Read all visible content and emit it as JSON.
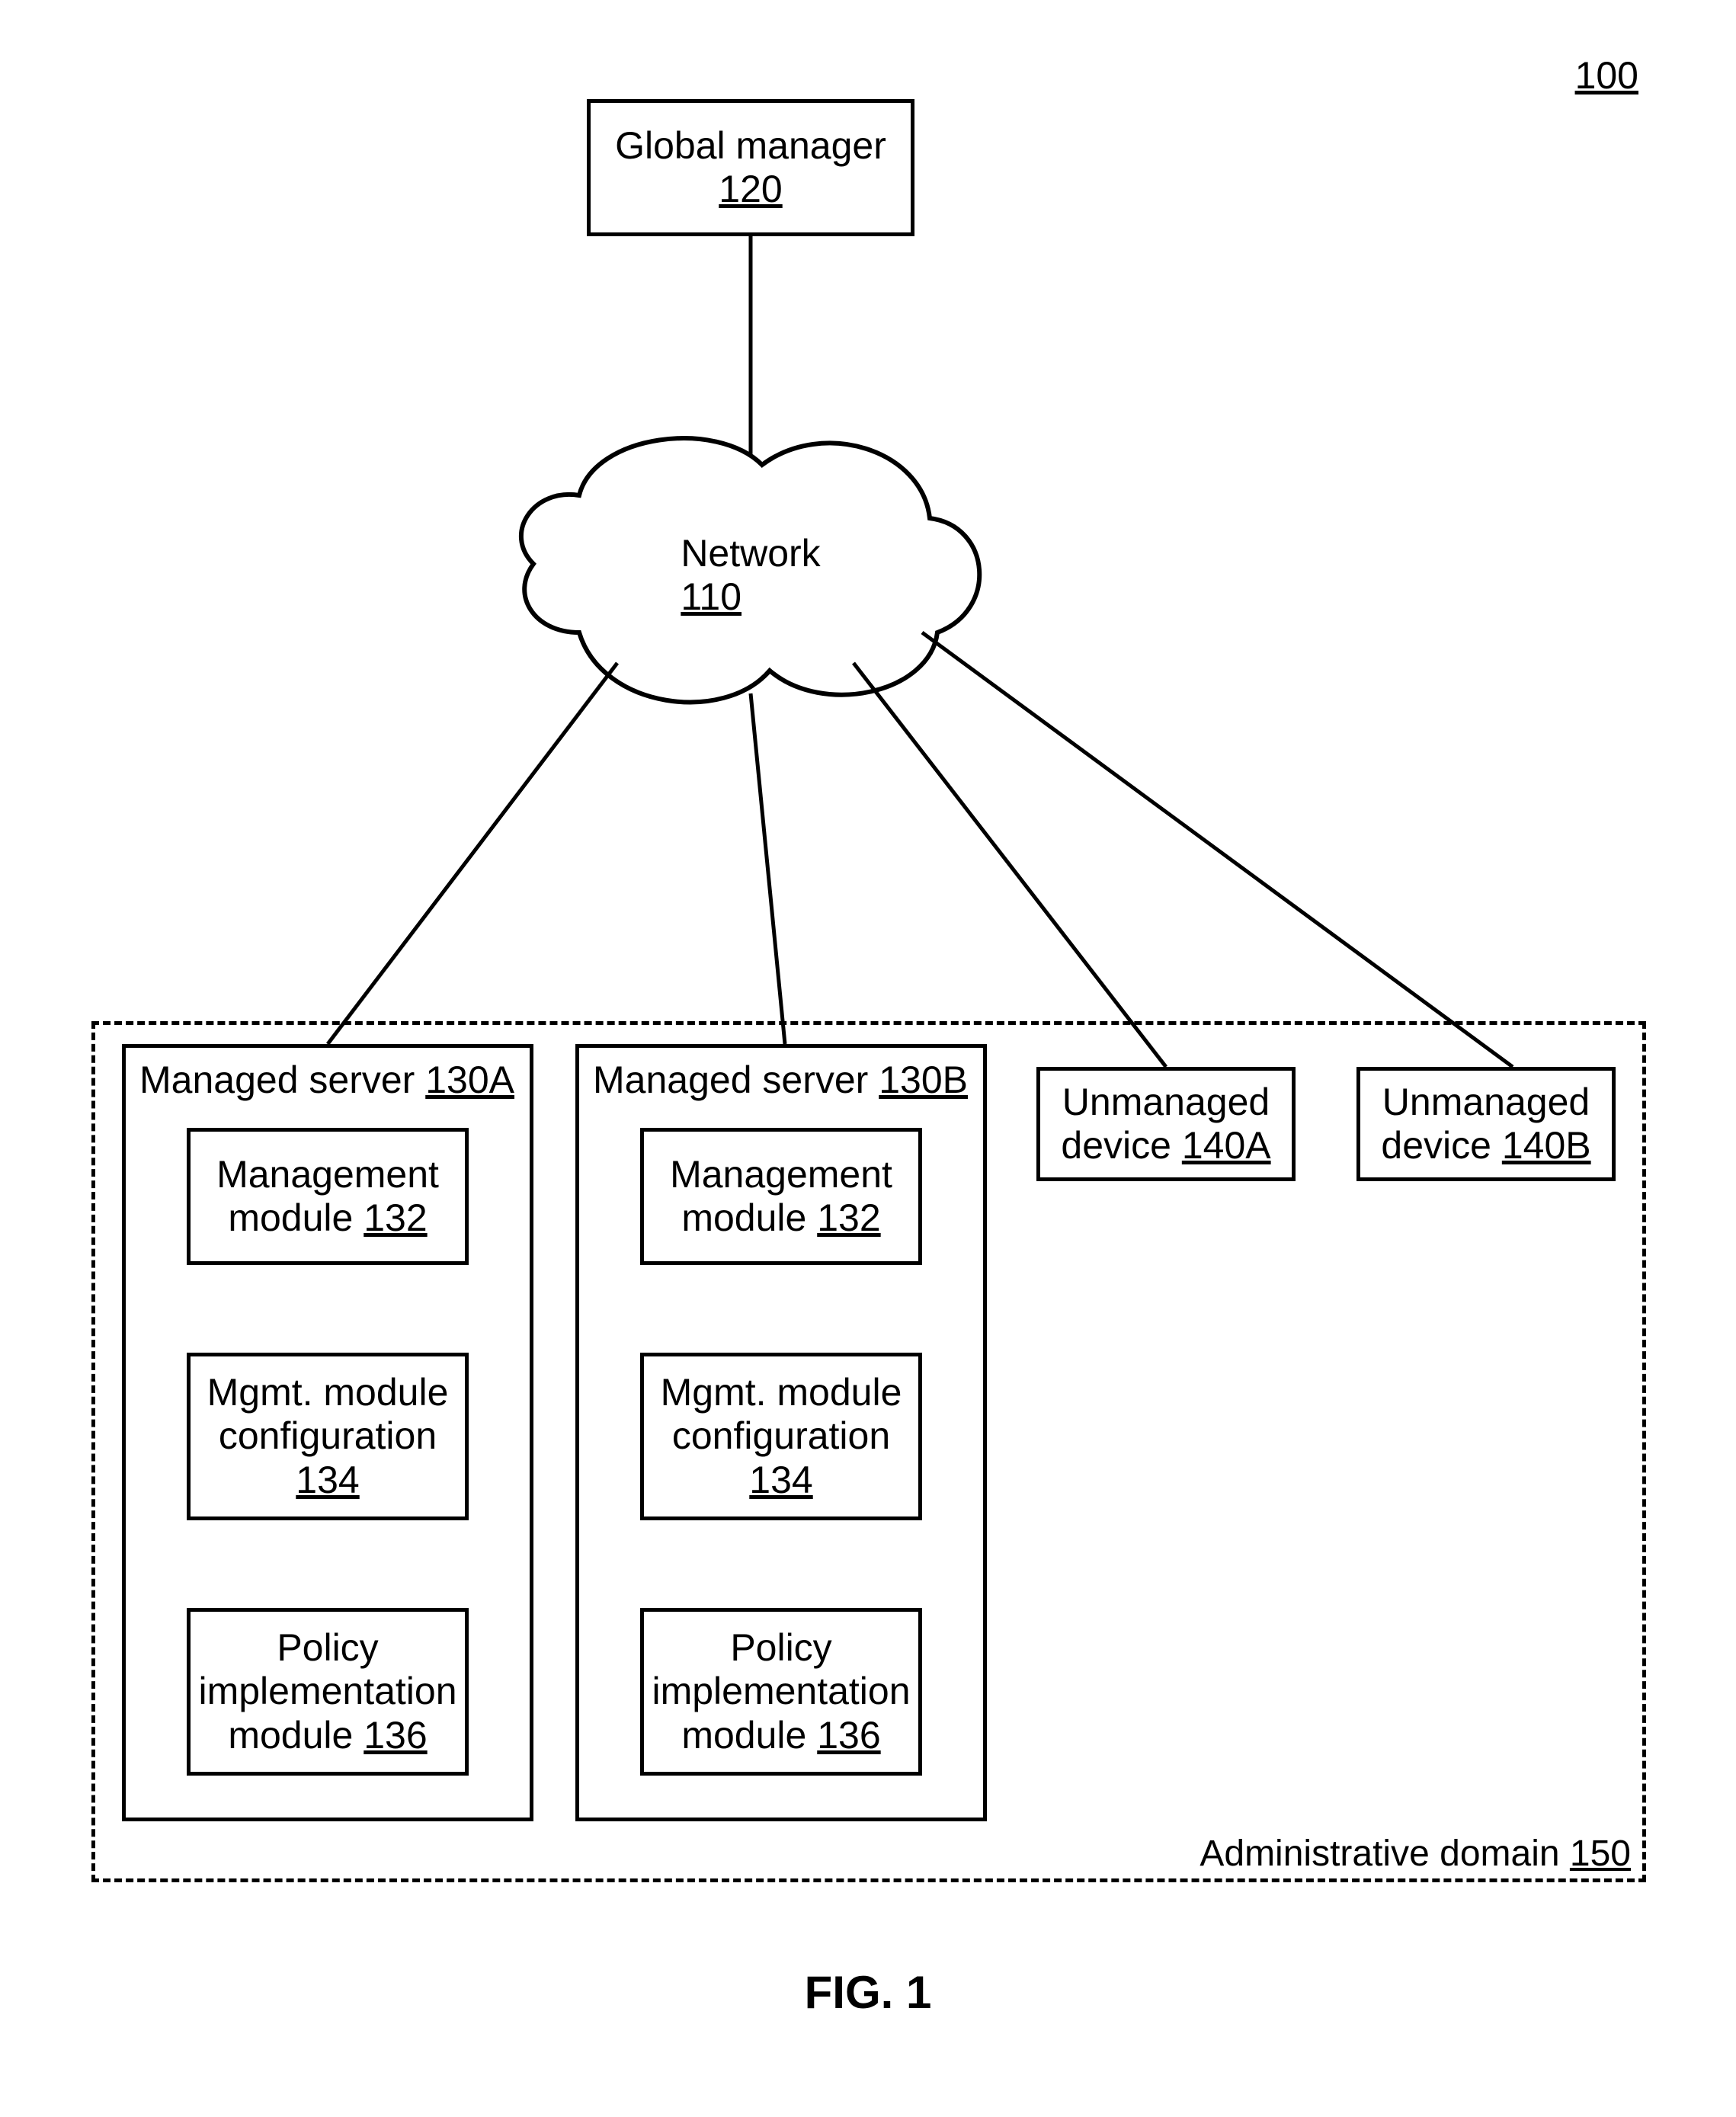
{
  "figure_ref": "100",
  "figure_title": "FIG. 1",
  "global_manager": {
    "label": "Global manager",
    "ref": "120"
  },
  "network": {
    "label": "Network",
    "ref": "110"
  },
  "domain": {
    "label_prefix": "Administrative domain",
    "ref": "150"
  },
  "servers": {
    "a": {
      "title_prefix": "Managed server",
      "title_ref": "130A",
      "modules": {
        "mgmt": {
          "line1": "Management",
          "line2_prefix": "module",
          "ref": "132"
        },
        "config": {
          "line1": "Mgmt. module",
          "line2": "configuration",
          "ref": "134"
        },
        "policy": {
          "line1": "Policy",
          "line2": "implementation",
          "line3_prefix": "module",
          "ref": "136"
        }
      }
    },
    "b": {
      "title_prefix": "Managed server",
      "title_ref": "130B",
      "modules": {
        "mgmt": {
          "line1": "Management",
          "line2_prefix": "module",
          "ref": "132"
        },
        "config": {
          "line1": "Mgmt. module",
          "line2": "configuration",
          "ref": "134"
        },
        "policy": {
          "line1": "Policy",
          "line2": "implementation",
          "line3_prefix": "module",
          "ref": "136"
        }
      }
    }
  },
  "unmanaged": {
    "a": {
      "line1": "Unmanaged",
      "line2_prefix": "device",
      "ref": "140A"
    },
    "b": {
      "line1": "Unmanaged",
      "line2_prefix": "device",
      "ref": "140B"
    }
  }
}
